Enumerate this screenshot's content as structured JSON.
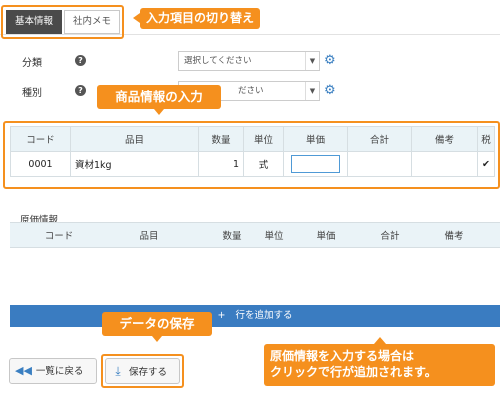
{
  "tabs": [
    {
      "label": "基本情報",
      "active": true
    },
    {
      "label": "社内メモ",
      "active": false
    }
  ],
  "callouts": {
    "tab_switch": "入力項目の切り替え",
    "product_info": "商品情報の入力",
    "save_data": "データの保存",
    "add_row_hint_line1": "原価情報を入力する場合は",
    "add_row_hint_line2": "クリックで行が追加されます。"
  },
  "form": {
    "category_label": "分類",
    "category_value": "選択してください",
    "type_label": "種別",
    "type_value": "ださい"
  },
  "product_table": {
    "headers": [
      "コード",
      "品目",
      "数量",
      "単位",
      "単価",
      "合計",
      "備考",
      "税"
    ],
    "rows": [
      {
        "code": "0001",
        "item": "資材1kg",
        "qty": "1",
        "unit": "式",
        "unit_price": "",
        "total": "",
        "note": "",
        "tax": "✔"
      }
    ]
  },
  "cost_section": {
    "title": "原価情報",
    "headers": [
      "コード",
      "品目",
      "数量",
      "単位",
      "単価",
      "合計",
      "備考"
    ]
  },
  "add_row": {
    "icon": "+",
    "label": "行を追加する"
  },
  "buttons": {
    "back": "一覧に戻る",
    "save": "保存する"
  },
  "colors": {
    "accent": "#f5901e",
    "primary": "#3a7cc1",
    "tab_active": "#4a4a4a",
    "table_header": "#eaf3f7"
  },
  "icons": {
    "help": "question-circle-icon",
    "settings": "gear-icon",
    "back": "double-chevron-left-icon",
    "save": "download-icon",
    "tax_check": "check-icon"
  }
}
